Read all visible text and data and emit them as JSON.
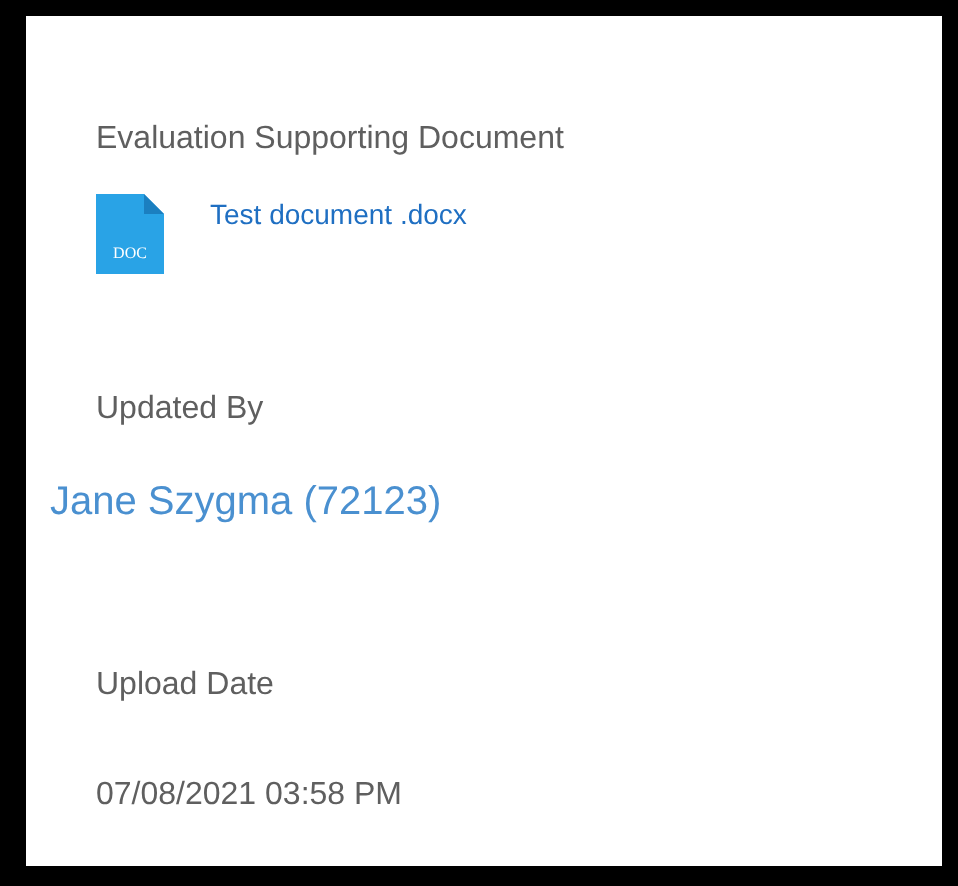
{
  "sections": [
    {
      "kind": "file",
      "label": "Evaluation Supporting Document",
      "file": {
        "icon_text": "DOC",
        "name": "Test document .docx"
      }
    },
    {
      "kind": "person",
      "label": "Updated By",
      "value": "Jane Szygma (72123)"
    },
    {
      "kind": "text",
      "label": "Upload Date",
      "value": "07/08/2021 03:58 PM"
    }
  ]
}
